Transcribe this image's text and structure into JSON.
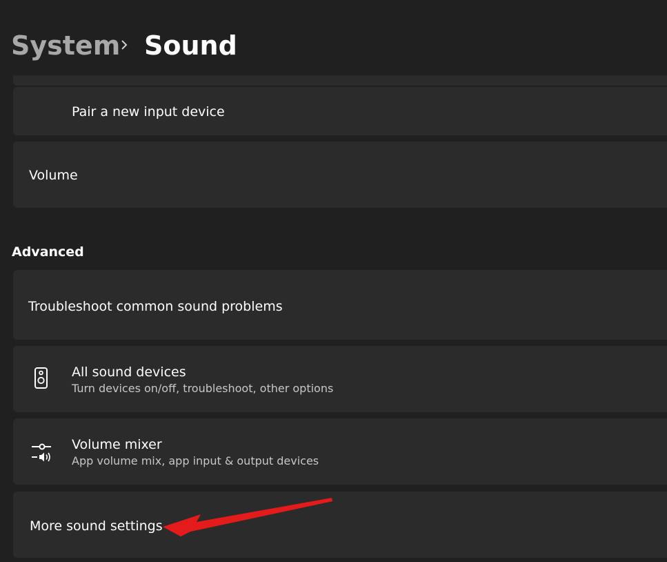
{
  "breadcrumb": {
    "parent": "System",
    "current": "Sound"
  },
  "rows": {
    "pair_input": {
      "title": "Pair a new input device"
    },
    "volume": {
      "title": "Volume"
    }
  },
  "advanced": {
    "heading": "Advanced",
    "troubleshoot": {
      "title": "Troubleshoot common sound problems"
    },
    "all_devices": {
      "title": "All sound devices",
      "subtitle": "Turn devices on/off, troubleshoot, other options",
      "icon": "speaker-icon"
    },
    "volume_mixer": {
      "title": "Volume mixer",
      "subtitle": "App volume mix, app input & output devices",
      "icon": "volume-mixer-icon"
    },
    "more_settings": {
      "title": "More sound settings"
    }
  },
  "colors": {
    "background": "#202020",
    "card": "#2b2b2b",
    "annotation_arrow": "#e31b1b"
  }
}
